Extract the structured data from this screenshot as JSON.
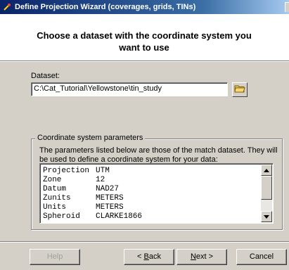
{
  "window": {
    "title": "Define Projection Wizard (coverages, grids, TINs)",
    "title_color": "#0a246a"
  },
  "header": {
    "heading": "Choose a dataset with the coordinate system you want to use"
  },
  "dataset": {
    "label": "Dataset:",
    "value": "C:\\Cat_Tutorial\\Yellowstone\\tin_study",
    "browse_icon": "folder-icon"
  },
  "coordinate_group": {
    "title": "Coordinate system parameters",
    "description": "The parameters listed below are those of the match dataset.  They will be used to define a coordinate system for your data:",
    "rows": [
      {
        "key": "Projection",
        "value": "UTM"
      },
      {
        "key": "Zone",
        "value": "12"
      },
      {
        "key": "Datum",
        "value": "NAD27"
      },
      {
        "key": "Zunits",
        "value": "METERS"
      },
      {
        "key": "Units",
        "value": "METERS"
      },
      {
        "key": "Spheroid",
        "value": "CLARKE1866"
      }
    ]
  },
  "buttons": {
    "help": "Help",
    "back_prefix": "< ",
    "back_hotkey": "B",
    "back_rest": "ack",
    "next_hotkey": "N",
    "next_rest": "ext >",
    "cancel": "Cancel"
  }
}
